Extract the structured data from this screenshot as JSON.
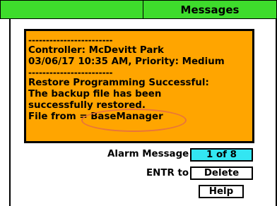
{
  "header": {
    "title": "Messages"
  },
  "message": {
    "separator1": "------------------------",
    "controller": "Controller: McDevitt Park",
    "datetime_priority": "03/06/17 10:35 AM, Priority: Medium",
    "separator2": "------------------------",
    "line1": "Restore Programming Successful:",
    "line2": "The backup file has been",
    "line3": "successfully restored.",
    "line4": "File from = BaseManager"
  },
  "footer": {
    "alarm_label": "Alarm Message",
    "alarm_count": "1 of 8",
    "entr_label": "ENTR to",
    "delete_label": "Delete",
    "help_label": "Help"
  },
  "colors": {
    "header_bg": "#3edc2c",
    "panel_bg": "#ffa500",
    "counter_bg": "#33e6f2",
    "highlight": "#e8743c"
  }
}
